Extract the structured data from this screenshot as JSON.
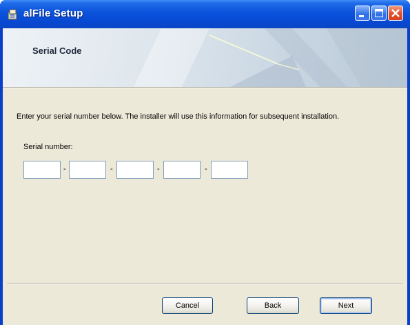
{
  "window": {
    "title": "alFile Setup",
    "icons": {
      "app": "installer-icon",
      "minimize": "minimize-icon",
      "maximize": "maximize-icon",
      "close": "close-icon"
    }
  },
  "banner": {
    "title": "Serial Code"
  },
  "content": {
    "description": "Enter your serial number below. The installer will use this information for subsequent installation.",
    "serial_label": "Serial number:",
    "separator": "-",
    "fields": [
      {
        "value": ""
      },
      {
        "value": ""
      },
      {
        "value": ""
      },
      {
        "value": ""
      },
      {
        "value": ""
      }
    ]
  },
  "buttons": {
    "cancel": "Cancel",
    "back": "Back",
    "next": "Next"
  },
  "colors": {
    "titlebar": "#0a52dc",
    "client_bg": "#ece9d8",
    "close_button": "#e0502c"
  }
}
